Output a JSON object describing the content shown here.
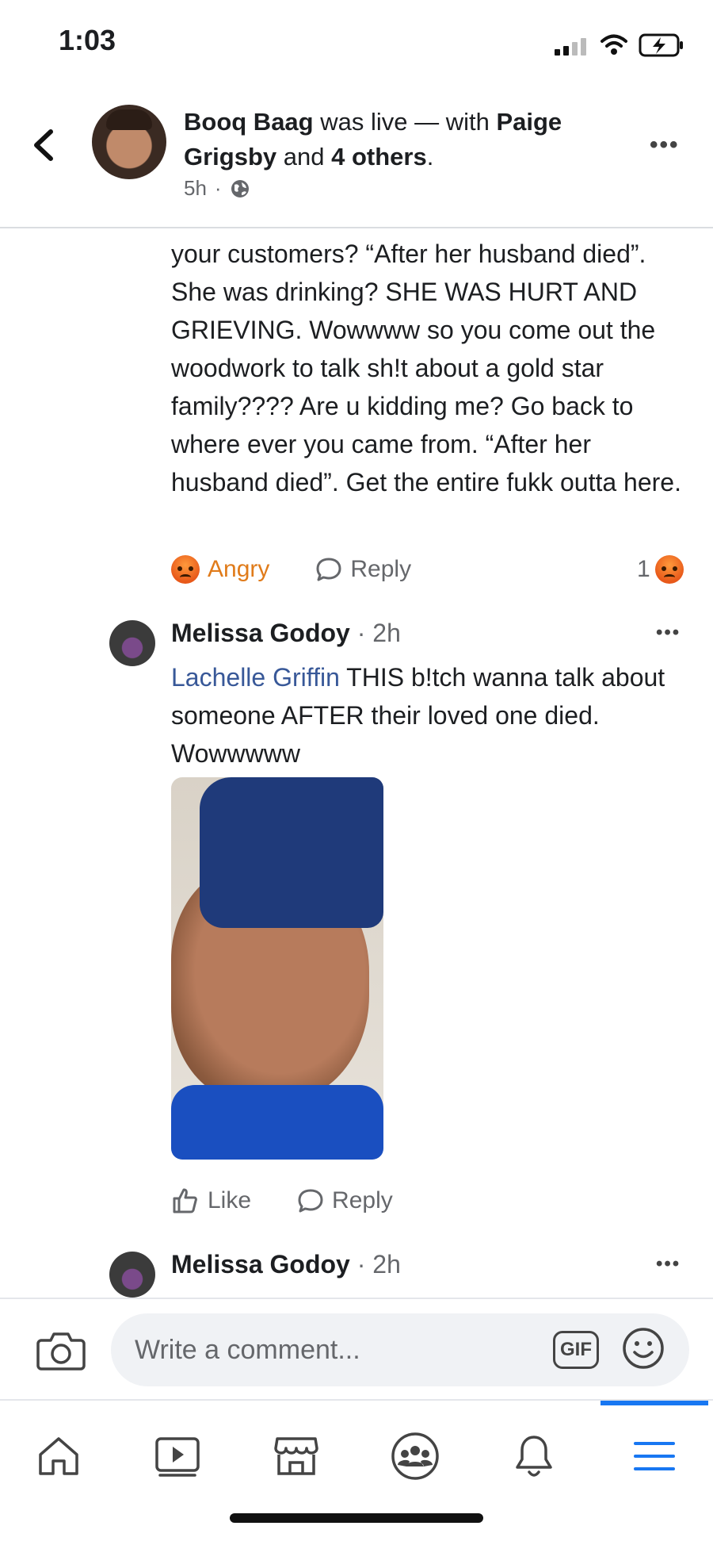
{
  "status_bar": {
    "time": "1:03"
  },
  "header": {
    "author": "Booq Baag",
    "was_live": " was live — with ",
    "tagged": "Paige Grigsby",
    "and_text": " and ",
    "others": "4 others",
    "period": ".",
    "age": "5h",
    "separator": "·"
  },
  "comment_1": {
    "text": "your customers? “After her husband died”. She was drinking? SHE WAS HURT AND GRIEVING. Wowwww so you come out the woodwork to talk sh!t about a gold star family???? Are u kidding me? Go back to where ever you came from. “After her husband died”. Get the entire fukk outta here.",
    "reaction_label": "Angry",
    "reply_label": "Reply",
    "reaction_count": "1"
  },
  "comment_2": {
    "name": "Melissa Godoy",
    "time": " · 2h",
    "mention": "Lachelle Griffin",
    "text": " THIS b!tch wanna talk about someone AFTER their loved one died. Wowwwww",
    "like_label": "Like",
    "reply_label": "Reply"
  },
  "comment_3": {
    "name": "Melissa Godoy",
    "time": " · 2h"
  },
  "composer": {
    "placeholder": "Write a comment...",
    "gif_label": "GIF"
  },
  "tabs": [
    "home",
    "watch",
    "marketplace",
    "groups",
    "notifications",
    "menu"
  ],
  "colors": {
    "accent": "#1877f2",
    "angry": "#e07b1a",
    "mention": "#385898"
  }
}
